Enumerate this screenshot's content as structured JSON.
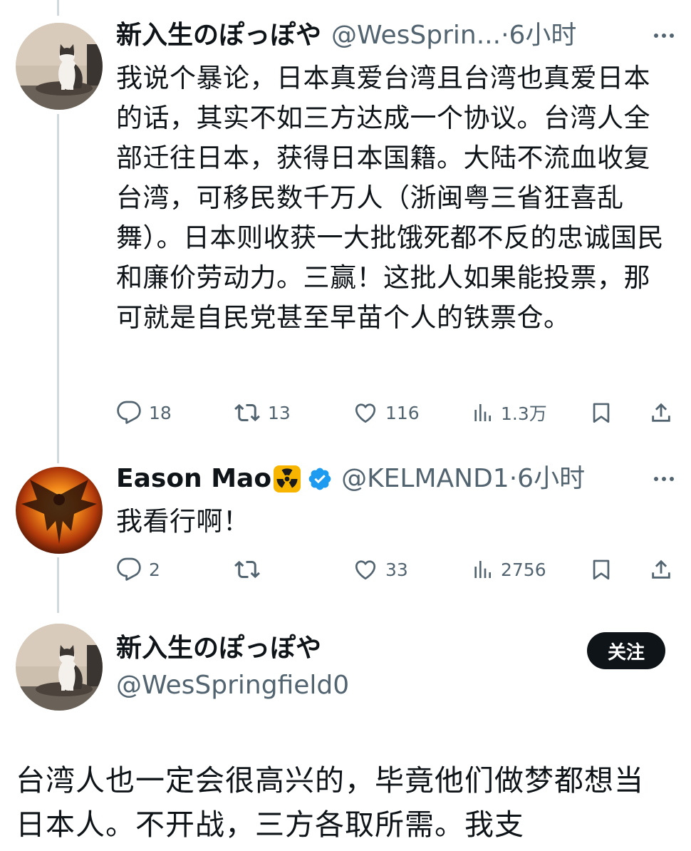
{
  "tweet1": {
    "display_name": "新入生のぽっぽや",
    "handle": "@WesSprin...",
    "time": "·6小时",
    "text": "我说个暴论，日本真爱台湾且台湾也真爱日本的话，其实不如三方达成一个协议。台湾人全部迁往日本，获得日本国籍。大陆不流血收复台湾，可移民数千万人（浙闽粤三省狂喜乱舞）。日本则收获一大批饿死都不反的忠诚国民和廉价劳动力。三赢！这批人如果能投票，那可就是自民党甚至早苗个人的铁票仓。",
    "replies": "18",
    "retweets": "13",
    "likes": "116",
    "views": "1.3万"
  },
  "tweet2": {
    "display_name": "Eason Mao",
    "handle": "@KELMAND1",
    "time": "·6小时",
    "text": "我看行啊！",
    "replies": "2",
    "retweets": "",
    "likes": "33",
    "views": "2756"
  },
  "tweet3": {
    "display_name": "新入生のぽっぽや",
    "handle": "@WesSpringfield0",
    "follow_label": "关注",
    "text": "台湾人也一定会很高兴的，毕竟他们做梦都想当日本人。不开战，三方各取所需。我支"
  },
  "colors": {
    "secondary_text": "#536471",
    "verified_blue": "#1d9bf0",
    "thread_line": "#cfd9de"
  },
  "icons": {
    "reply": "reply-icon",
    "retweet": "retweet-icon",
    "like": "heart-icon",
    "views": "views-icon",
    "bookmark": "bookmark-icon",
    "share": "share-icon",
    "more": "more-icon",
    "verified": "verified-badge-icon"
  }
}
